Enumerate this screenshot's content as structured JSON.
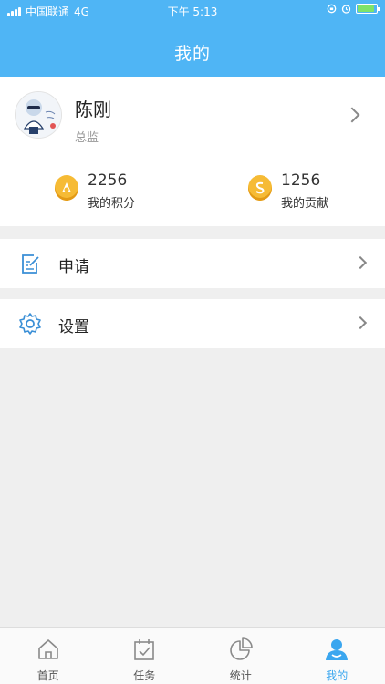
{
  "status_bar": {
    "carrier": "中国联通",
    "network": "4G",
    "time": "下午 5:13"
  },
  "header": {
    "title": "我的"
  },
  "profile": {
    "name": "陈刚",
    "role": "总监",
    "avatar_icon": "avatar-cartoon"
  },
  "stats": {
    "points_value": "2256",
    "points_label": "我的积分",
    "points_icon": "coin-icon",
    "contribution_value": "1256",
    "contribution_label": "我的贡献",
    "contribution_icon": "coin-icon"
  },
  "menu": [
    {
      "label": "申请",
      "icon": "edit-icon"
    },
    {
      "label": "设置",
      "icon": "gear-icon"
    }
  ],
  "tabbar": {
    "items": [
      {
        "label": "首页",
        "icon": "home-icon",
        "active": false
      },
      {
        "label": "任务",
        "icon": "calendar-check-icon",
        "active": false
      },
      {
        "label": "统计",
        "icon": "pie-chart-icon",
        "active": false
      },
      {
        "label": "我的",
        "icon": "user-icon",
        "active": true
      }
    ]
  },
  "colors": {
    "accent": "#4fb5f5",
    "active_tab": "#3aa6ef",
    "coin": "#f6bb35",
    "background": "#efefef"
  }
}
